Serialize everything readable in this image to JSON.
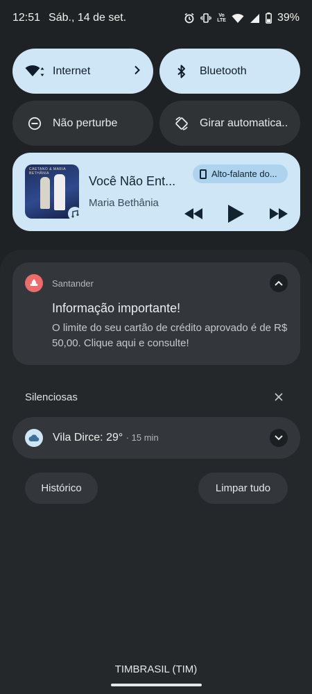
{
  "status_bar": {
    "time": "12:51",
    "date": "Sáb., 14 de set.",
    "network_badge_top": "Vo",
    "network_badge_bottom": "LTE",
    "battery": "39%",
    "icons": [
      "alarm-icon",
      "vibrate-icon",
      "volte-icon",
      "wifi-icon",
      "signal-icon",
      "battery-icon"
    ]
  },
  "quick_settings": {
    "tiles": [
      {
        "label": "Internet",
        "icon": "wifi-icon",
        "state": "on"
      },
      {
        "label": "Bluetooth",
        "icon": "bluetooth-icon",
        "state": "on"
      },
      {
        "label": "Não perturbe",
        "icon": "do-not-disturb-icon",
        "state": "off"
      },
      {
        "label": "Girar automatica..",
        "icon": "auto-rotate-icon",
        "state": "off"
      }
    ]
  },
  "media": {
    "title": "Você Não Ent...",
    "artist": "Maria Bethânia",
    "output_device": "Alto-falante do...",
    "album_text": "CAETANO & MARIA BETHÂNIA",
    "controls": [
      "previous-icon",
      "play-icon",
      "next-icon"
    ]
  },
  "notifications": [
    {
      "app": "Santander",
      "title": "Informação importante!",
      "body": "O limite do seu cartão de crédito aprovado é de R$ 50,00. Clique aqui e consulte!"
    }
  ],
  "silent_section": {
    "label": "Silenciosas",
    "items": [
      {
        "text": "Vila Dirce: 29°",
        "time": "· 15 min"
      }
    ]
  },
  "actions": {
    "history": "Histórico",
    "clear_all": "Limpar tudo"
  },
  "carrier": "TIMBRASIL (TIM)",
  "colors": {
    "accent_tile": "#cfe6f7",
    "shade_background": "#24282b",
    "card_background": "#33373b",
    "santander_red": "#ec6b6b"
  }
}
